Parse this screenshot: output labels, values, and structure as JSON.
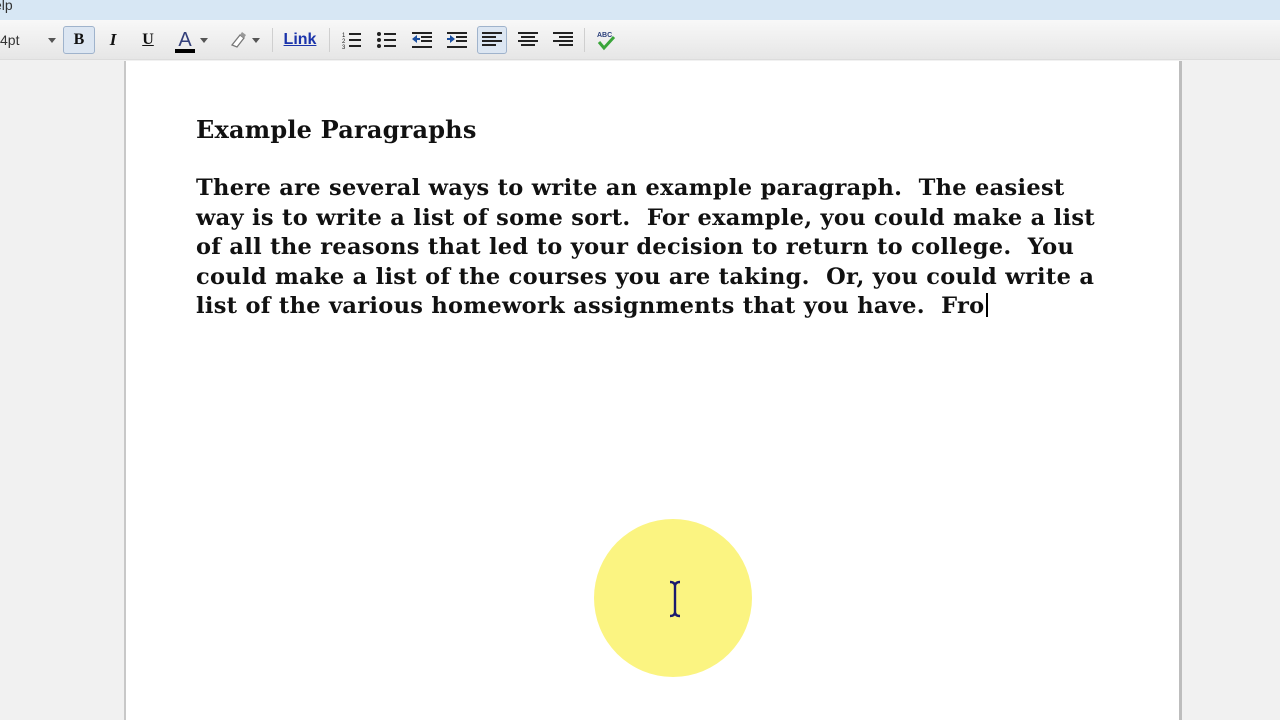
{
  "menubar": {
    "visible_menu": "elp"
  },
  "toolbar": {
    "font_size": "4pt",
    "bold_label": "B",
    "italic_label": "I",
    "underline_label": "U",
    "text_color_label": "A",
    "link_label": "Link",
    "active_buttons": [
      "bold",
      "align-left"
    ],
    "text_color": "#000000",
    "icons": [
      "numbered-list-icon",
      "bulleted-list-icon",
      "outdent-icon",
      "indent-icon",
      "align-left-icon",
      "align-center-icon",
      "align-right-icon",
      "spellcheck-icon"
    ],
    "spellcheck_label": "ABC"
  },
  "document": {
    "title": "Example Paragraphs",
    "body_lines": [
      "There are several ways to write an example paragraph.  The easiest",
      "way is to write a list of some sort.  For example, you could make a list",
      "of all the reasons that led to your decision to return to college.  You",
      "could make a list of the courses you are taking.  Or, you could write a",
      "list of the various homework assignments that you have.  Fro"
    ]
  },
  "cursor": {
    "type": "i-beam",
    "highlight_color": "#fbf481"
  }
}
